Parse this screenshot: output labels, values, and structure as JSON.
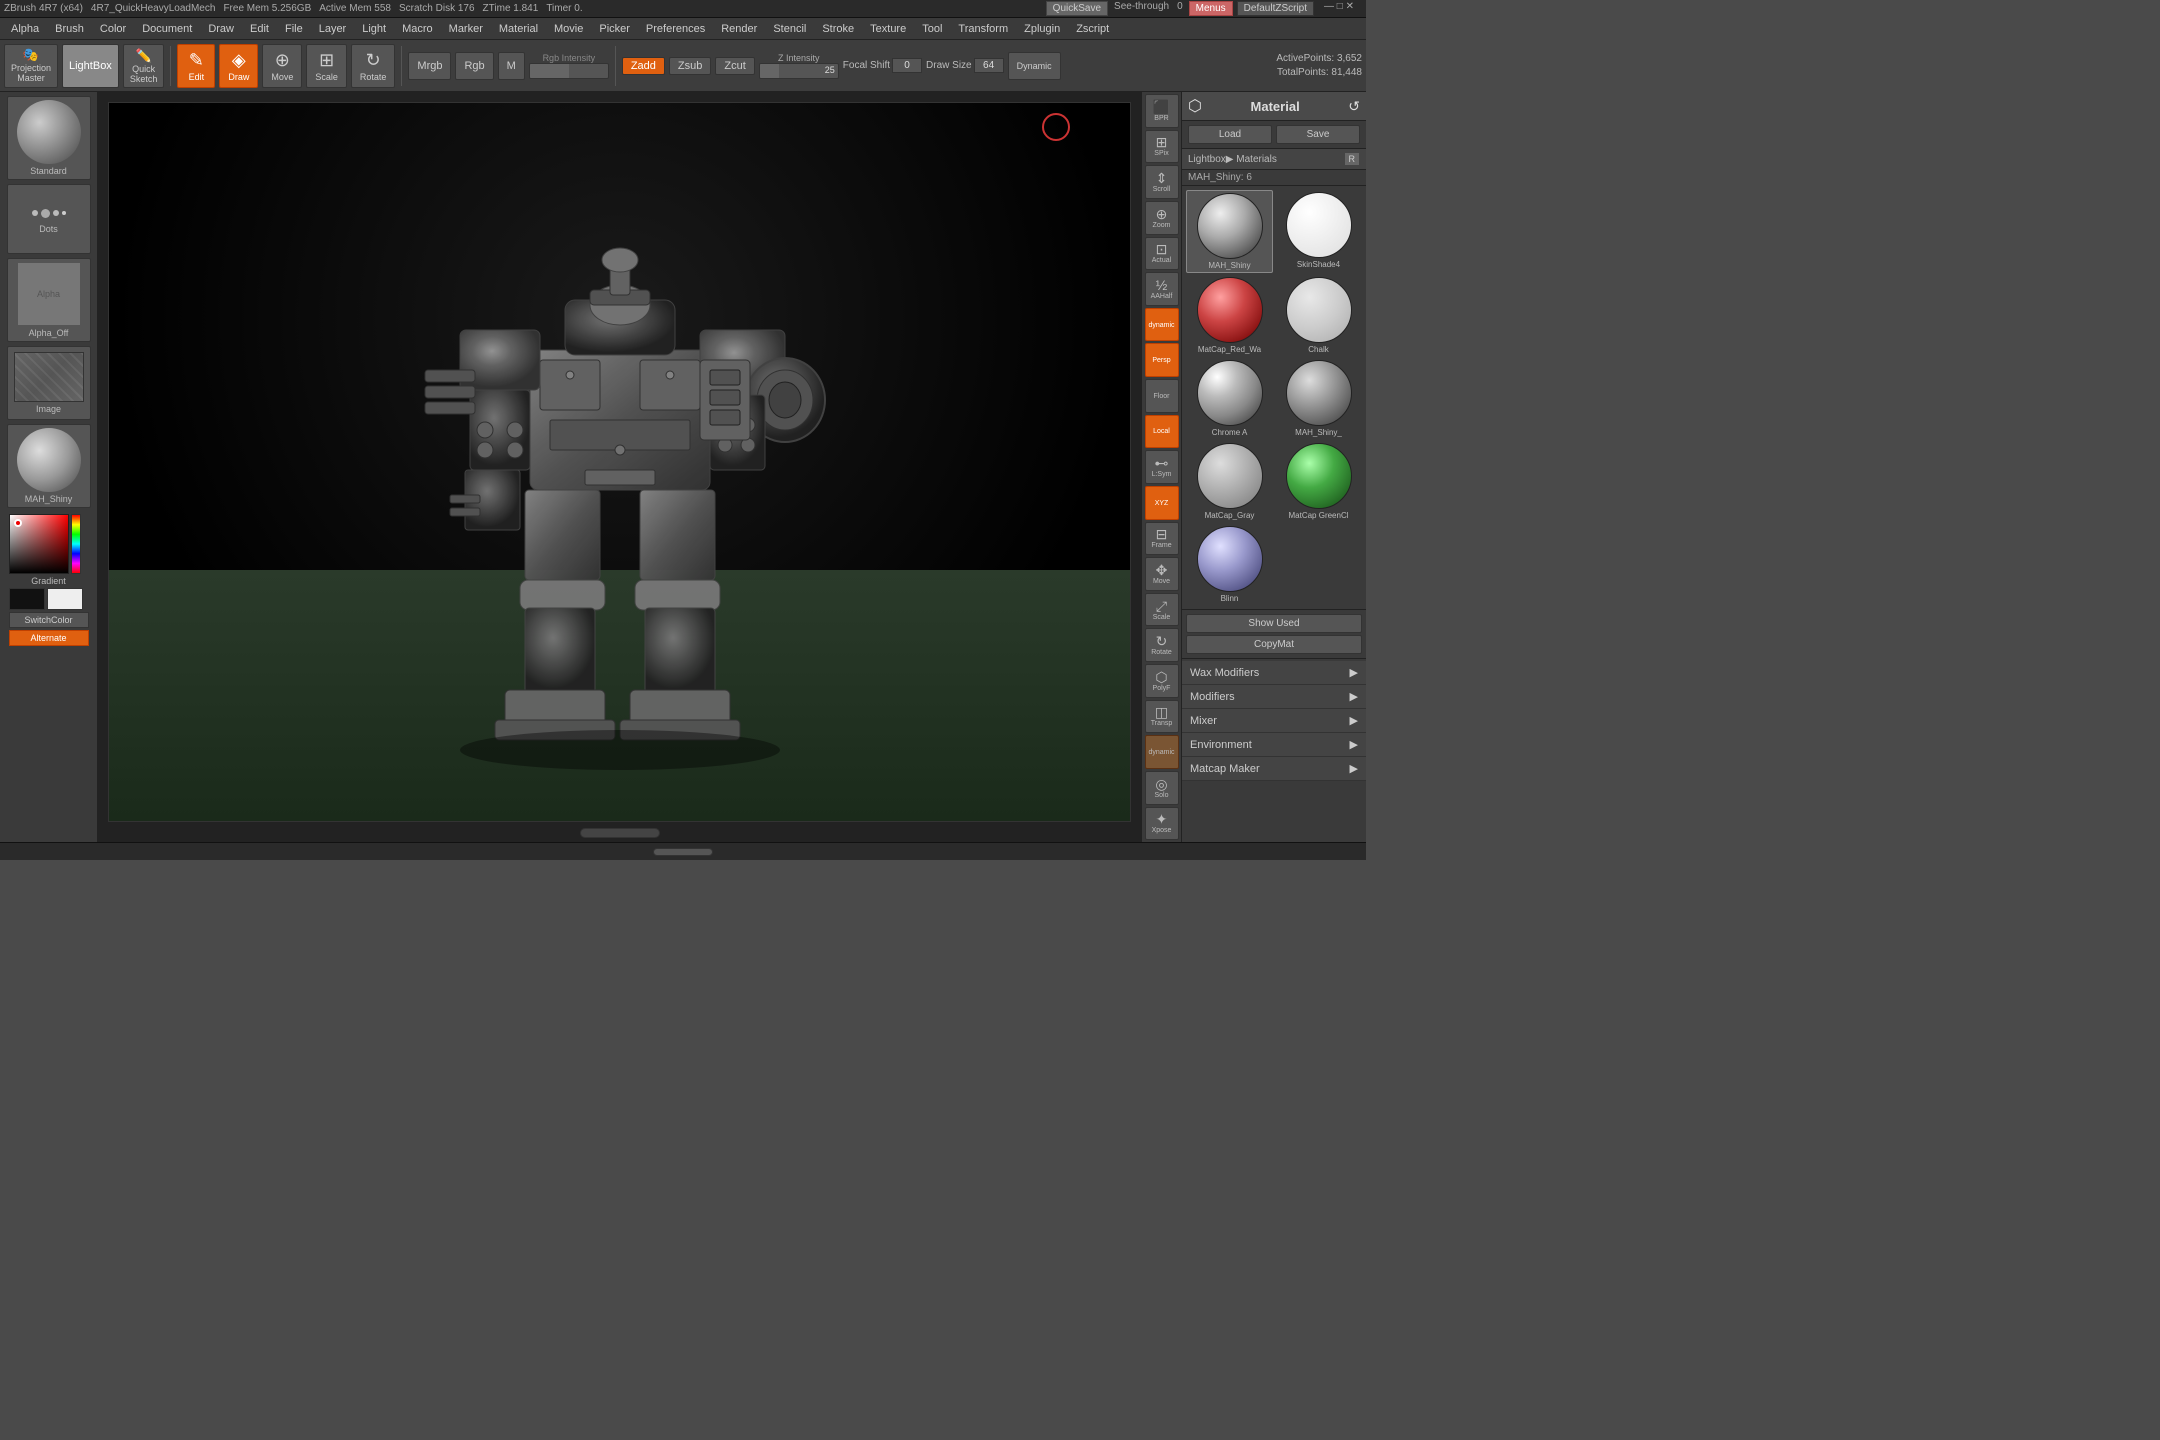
{
  "titlebar": {
    "app": "ZBrush 4R7 (x64)",
    "file": "4R7_QuickHeavyLoadMech",
    "free_mem": "Free Mem 5.256GB",
    "active_mem": "Active Mem 558",
    "scratch_disk": "Scratch Disk 176",
    "ztime": "ZTime 1.841",
    "timer": "Timer 0.",
    "quicksave": "QuickSave",
    "seethrough": "See-through",
    "seethrough_val": "0",
    "menus": "Menus",
    "defaultzscript": "DefaultZScript"
  },
  "menubar": {
    "items": [
      "Alpha",
      "Brush",
      "Color",
      "Document",
      "Draw",
      "Edit",
      "File",
      "Layer",
      "Light",
      "Macro",
      "Marker",
      "Material",
      "Movie",
      "Picker",
      "Preferences",
      "Render",
      "Stencil",
      "Stroke",
      "Texture",
      "Tool",
      "Transform",
      "Zplugin",
      "Zscript"
    ]
  },
  "toolbar": {
    "projection_master": "Projection\nMaster",
    "lightbox": "LightBox",
    "quick_sketch": "Quick\nSketch",
    "edit": "Edit",
    "draw": "Draw",
    "move": "Move",
    "scale": "Scale",
    "rotate": "Rotate",
    "mrgb": "Mrgb",
    "rgb": "Rgb",
    "m": "M",
    "zadd": "Zadd",
    "zsub": "Zsub",
    "zcut": "Zcut",
    "focal_shift": "Focal Shift",
    "focal_val": "0",
    "z_intensity_label": "Z Intensity",
    "z_intensity_val": "25",
    "draw_size_label": "Draw Size",
    "draw_size_val": "64",
    "dynamic": "Dynamic",
    "active_points": "ActivePoints: 3,652",
    "total_points": "TotalPoints: 81,448"
  },
  "left_panel": {
    "standard_label": "Standard",
    "dots_label": "Dots",
    "alpha_off_label": "Alpha_Off",
    "image_label": "Image",
    "mah_shiny_label": "MAH_Shiny",
    "gradient_label": "Gradient",
    "switch_color": "SwitchColor",
    "alternate": "Alternate"
  },
  "right_sidebar": {
    "buttons": [
      {
        "label": "BPR",
        "icon": "⬛"
      },
      {
        "label": "SPix",
        "icon": "⊞"
      },
      {
        "label": "Scroll",
        "icon": "⇕"
      },
      {
        "label": "Zoom",
        "icon": "⊕"
      },
      {
        "label": "Actual",
        "icon": "⊡"
      },
      {
        "label": "AAHalf",
        "icon": "⊡"
      },
      {
        "label": "dynamic",
        "active": true
      },
      {
        "label": "Persp",
        "active": true
      },
      {
        "label": "Floor"
      },
      {
        "label": "Local",
        "active": true
      },
      {
        "label": "L:Sym"
      },
      {
        "label": "XYZ",
        "active": true
      },
      {
        "label": "Frame"
      },
      {
        "label": "Move"
      },
      {
        "label": "Scale"
      },
      {
        "label": "Rotate"
      },
      {
        "label": "PolyF"
      },
      {
        "label": "Transp"
      },
      {
        "label": "dynamic2"
      },
      {
        "label": "Solo"
      },
      {
        "label": "Xpose"
      }
    ]
  },
  "material_panel": {
    "title": "Material",
    "load_btn": "Load",
    "save_btn": "Save",
    "lightbox_label": "Lightbox▶ Materials",
    "r_label": "R",
    "count_label": "MAH_Shiny: 6",
    "materials": [
      {
        "name": "MAH_Shiny",
        "style": "mat-mah-shiny",
        "selected": true
      },
      {
        "name": "SkinShade4",
        "style": "mat-skinshade"
      },
      {
        "name": "MatCap_Red_Wa",
        "style": "mat-matcap-red"
      },
      {
        "name": "Chalk",
        "style": "mat-chalk"
      },
      {
        "name": "Chrome A",
        "style": "mat-chrome"
      },
      {
        "name": "MAH_Shiny_",
        "style": "mat-mah-shiny2"
      },
      {
        "name": "MatCap_Gray",
        "style": "mat-matcap-gray"
      },
      {
        "name": "MatCap GreenCl",
        "style": "mat-matcap-green"
      },
      {
        "name": "Blinn",
        "style": "mat-blinn"
      }
    ],
    "show_used": "Show Used",
    "copy_mat": "CopyMat",
    "sections": [
      "Wax Modifiers",
      "Modifiers",
      "Mixer",
      "Environment",
      "Matcap Maker"
    ]
  },
  "canvas": {
    "scroll_label": "▼"
  }
}
